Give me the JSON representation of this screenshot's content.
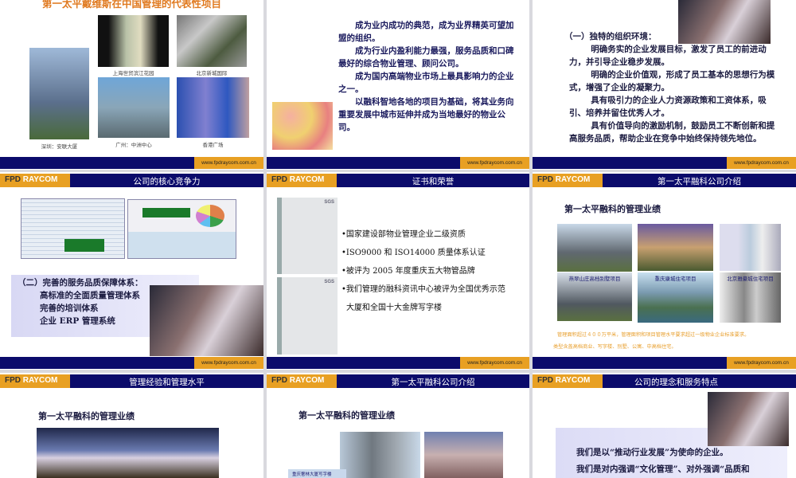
{
  "footer_url": "www.fpdraycom.com.cn",
  "logo": {
    "main": "FPD",
    "sub": "RAYCOM"
  },
  "slides": {
    "s1": {
      "title": "第一太平戴维斯在中国管理的代表性项目",
      "captions": [
        "深圳：安联大厦",
        "上海世贸滨江花园",
        "北京新城国际",
        "广州：中洲中心",
        "香港广场"
      ]
    },
    "s2": {
      "paras": [
        "成为业内成功的典范，成为业界精英可望加盟的组织。",
        "成为行业内盈利能力最强，服务品质和口碑最好的综合物业管理、顾问公司。",
        "成为国内高端物业市场上最具影响力的企业之一。",
        "以融科智地各地的项目为基础，将其业务向重要发展中城市延伸并成为当地最好的物业公司。"
      ]
    },
    "s3": {
      "heading": "（一）独特的组织环境：",
      "paras": [
        "明确务实的企业发展目标，激发了员工的前进动力，并引导企业稳步发展。",
        "明确的企业价值观，形成了员工基本的思想行为模式，增强了企业的凝聚力。",
        "具有吸引力的企业人力资源政策和工资体系，吸引、培养并留住优秀人才。",
        "具有价值导向的激励机制，鼓励员工不断创新和提高服务品质，帮助企业在竞争中始终保持领先地位。"
      ]
    },
    "s4": {
      "title": "公司的核心竞争力",
      "lines": [
        "（二）完善的服务品质保障体系：",
        "高标准的全面质量管理体系",
        "完善的培训体系",
        "企业 ERP 管理系统"
      ]
    },
    "s5": {
      "title": "证书和荣誉",
      "bullets": [
        "•国家建设部物业管理企业二级资质",
        "•ISO9000 和 ISO14000 质量体系认证",
        "•被评为 2005 年度重庆五大物管品牌",
        "•我们管理的融科资讯中心被评为全国优秀示范",
        "大厦和全国十大金牌写字楼"
      ],
      "cert_label": "SGS"
    },
    "s6": {
      "title": "第一太平融科公司介绍",
      "subtitle": "第一太平融科的管理业绩",
      "captions": [
        "燕翠山庄高档别墅项目",
        "重庆康城住宅项目",
        "北京雅豪城住宅项目"
      ],
      "note": [
        "管理面积超过４００万平米，管理面积和项目管理水平要求超过一级物业企业标准要求。",
        "类型含盖高档商业、写字楼、别墅、公寓、中高档住宅。"
      ]
    },
    "s7": {
      "title": "管理经验和管理水平",
      "subtitle": "第一太平融科的管理业绩"
    },
    "s8": {
      "title": "第一太平融科公司介绍",
      "subtitle": "第一太平融科的管理业绩",
      "caption": "重庆奢林大厦写字楼"
    },
    "s9": {
      "title": "公司的理念和服务特点",
      "lines": [
        "我们是以“推动行业发展”为使命的企业。",
        "我们是对内强调“文化管理”、对外强调“品质和"
      ]
    }
  }
}
